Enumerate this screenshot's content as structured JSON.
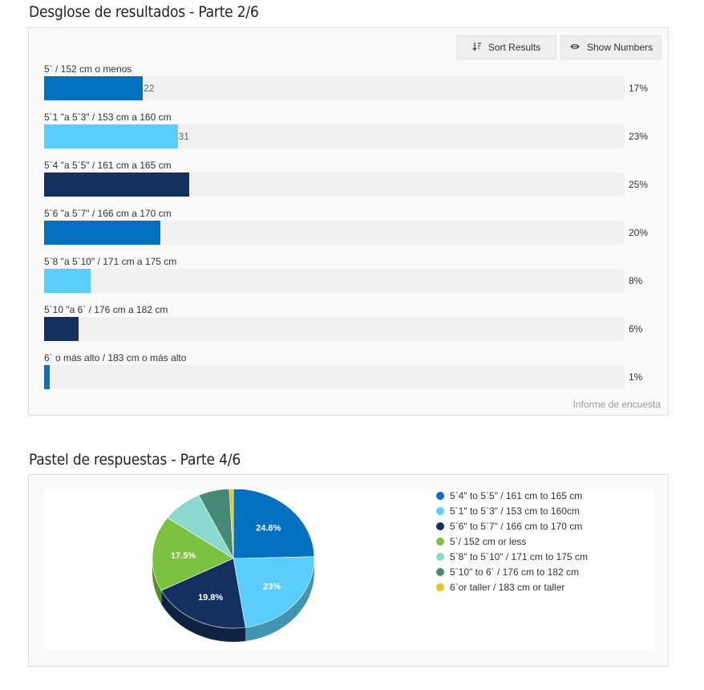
{
  "section1": {
    "title": "Desglose de resultados - Parte 2/6",
    "sort_label": "Sort Results",
    "show_label": "Show Numbers",
    "footer": "Informe de encuesta"
  },
  "section2": {
    "title": "Pastel de respuestas - Parte 4/6"
  },
  "colors": {
    "blue": "#0470c0",
    "light_blue": "#5bcdfc",
    "navy": "#14305f",
    "green": "#7dc142",
    "mint": "#8ad9cc",
    "teal": "#458a76",
    "yellow": "#e2c52d"
  },
  "chart_data": [
    {
      "type": "bar",
      "orientation": "horizontal",
      "title": "Desglose de resultados - Parte 2/6",
      "categories": [
        "5` / 152 cm o menos",
        "5`1 \"a 5`3\" / 153 cm a 160 cm",
        "5`4 \"a 5`5\" / 161 cm a 165 cm",
        "5`6 \"a 5`7\" / 166 cm a 170 cm",
        "5`8 \"a 5`10\" / 171 cm a 175 cm",
        "5`10 \"a 6` / 176 cm a 182 cm",
        "6` o más alto / 183 cm o más alto"
      ],
      "values": [
        17,
        23,
        25,
        20,
        8,
        6,
        1
      ],
      "value_labels": [
        "17%",
        "23%",
        "25%",
        "20%",
        "8%",
        "6%",
        "1%"
      ],
      "counts": [
        "22",
        "31",
        "",
        "",
        "",
        "",
        ""
      ],
      "bar_colors": [
        "#0470c0",
        "#5bcdfc",
        "#14305f",
        "#0470c0",
        "#5bcdfc",
        "#14305f",
        "#0470c0"
      ],
      "xlim": [
        0,
        100
      ],
      "grid": false,
      "legend": "none"
    },
    {
      "type": "pie",
      "title": "Pastel de respuestas - Parte 4/6",
      "labels": [
        "5`4\" to 5`5\" / 161 cm to 165 cm",
        "5`1\" to 5`3\" / 153 cm to 160cm",
        "5`6\" to 5`7\" / 166 cm to 170 cm",
        "5`/ 152 cm or less",
        "5`8\" to 5`10\" / 171 cm to 175 cm",
        "5`10\" to 6` / 176 cm to 182 cm",
        "6`or taller / 183 cm or taller"
      ],
      "values": [
        24.6,
        23,
        19.8,
        17.5,
        8.1,
        6.2,
        0.8
      ],
      "slice_labels": [
        "24.6%",
        "23%",
        "19.8%",
        "17.5%",
        "",
        "",
        ""
      ],
      "colors": [
        "#0470c0",
        "#5bcdfc",
        "#14305f",
        "#7dc142",
        "#8ad9cc",
        "#458a76",
        "#e2c52d"
      ],
      "legend": "right",
      "style": "3d"
    }
  ]
}
